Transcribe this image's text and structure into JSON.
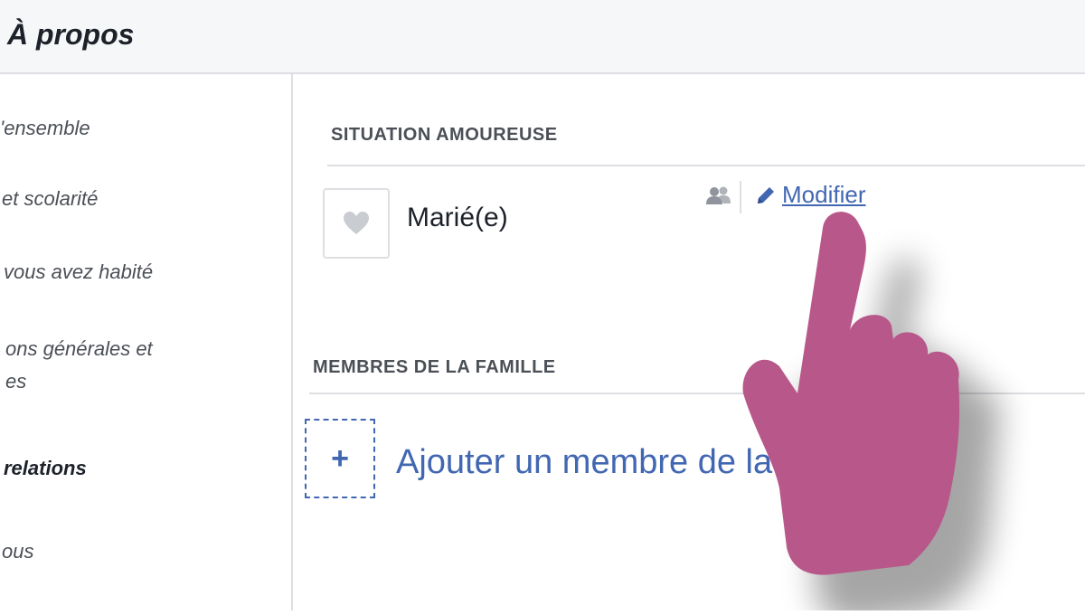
{
  "header": {
    "title": "À propos"
  },
  "sidebar": {
    "items": [
      {
        "label": "'ensemble",
        "active": false
      },
      {
        "label": "et scolarité",
        "active": false
      },
      {
        "label": "vous avez habité",
        "active": false
      },
      {
        "label": "ons générales et",
        "active": false
      },
      {
        "label": "es",
        "active": false
      },
      {
        "label": "relations",
        "active": true
      },
      {
        "label": "ous",
        "active": false
      }
    ]
  },
  "relationship": {
    "section_title": "SITUATION AMOUREUSE",
    "status": "Marié(e)",
    "audience_icon": "friends-icon",
    "edit_label": "Modifier"
  },
  "family": {
    "section_title": "MEMBRES DE LA FAMILLE",
    "add_label": "Ajouter un membre de la",
    "add_icon": "+"
  },
  "colors": {
    "link": "#4267b2",
    "hand": "#b8578a",
    "divider": "#dddfe2"
  }
}
